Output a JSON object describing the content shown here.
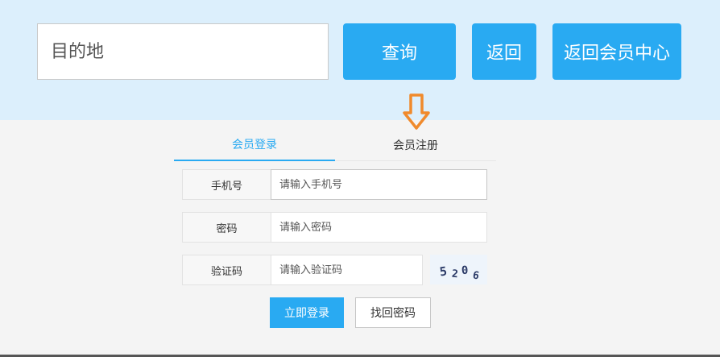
{
  "search": {
    "destination_placeholder": "目的地",
    "query_label": "查询",
    "back_label": "返回",
    "member_center_label": "返回会员中心"
  },
  "arrow_icon": "down-arrow-icon",
  "tabs": {
    "login": "会员登录",
    "register": "会员注册",
    "active": "login"
  },
  "form": {
    "phone": {
      "label": "手机号",
      "placeholder": "请输入手机号"
    },
    "password": {
      "label": "密码",
      "placeholder": "请输入密码"
    },
    "code": {
      "label": "验证码",
      "placeholder": "请输入验证码"
    },
    "captcha_chars": [
      "5",
      "2",
      "0",
      "6"
    ]
  },
  "actions": {
    "login_label": "立即登录",
    "forgot_label": "找回密码"
  },
  "colors": {
    "accent": "#29aaf2",
    "top_band": "#dceffc",
    "arrow": "#f08a2c",
    "captcha_text": "#2b3a67"
  }
}
